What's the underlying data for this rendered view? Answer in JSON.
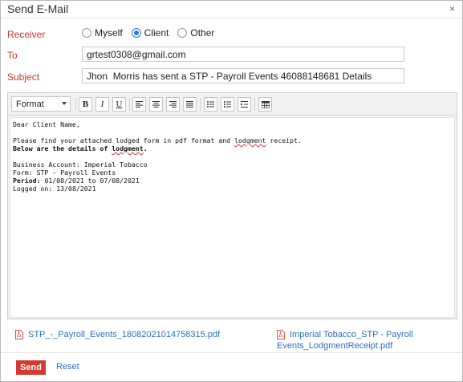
{
  "dialog": {
    "title": "Send E-Mail",
    "close_glyph": "×"
  },
  "receiver": {
    "label": "Receiver",
    "options": [
      {
        "label": "Myself",
        "checked": false
      },
      {
        "label": "Client",
        "checked": true
      },
      {
        "label": "Other",
        "checked": false
      }
    ]
  },
  "to": {
    "label": "To",
    "value": "grtest0308@gmail.com"
  },
  "subject": {
    "label": "Subject",
    "value": "Jhon  Morris has sent a STP - Payroll Events 46088148681 Details"
  },
  "toolbar": {
    "format_label": "Format",
    "buttons": {
      "bold": "B",
      "italic": "I",
      "underline": "U",
      "align_left_icon": "align-left-icon",
      "align_center_icon": "align-center-icon",
      "align_right_icon": "align-right-icon",
      "justify_icon": "justify-icon",
      "bullet_list_icon": "bullet-list-icon",
      "numbered_list_icon": "numbered-list-icon",
      "indent_icon": "indent-icon",
      "table_icon": "table-icon"
    }
  },
  "body": {
    "greeting": "Dear Client Name,",
    "line1_before": "Please find your attached lodged form in pdf format and ",
    "line1_spell": "lodgment",
    "line1_after": " receipt.",
    "line2_before": "Below are the details of ",
    "line2_spell": "lodgment",
    "line2_after": ".",
    "business_account": "Business Account: Imperial Tobacco",
    "form": "Form: STP - Payroll Events",
    "period_label": "Period:",
    "period_value": " 01/08/2021 to 07/08/2021",
    "lodged_on": "Logged on: 13/08/2021"
  },
  "attachments": [
    {
      "name": "STP_-_Payroll_Events_18082021014758315.pdf"
    },
    {
      "name_line1": "Imperial Tobacco_STP - Payroll",
      "name_line2": "Events_LodgmentReceipt.pdf"
    }
  ],
  "footer": {
    "send_label": "Send",
    "reset_label": "Reset"
  },
  "colors": {
    "accent": "#2a7ad6",
    "label_red": "#c8392b",
    "link_blue": "#2b6fc2",
    "send_red": "#d23a32",
    "pdf_red": "#e14b4b"
  }
}
